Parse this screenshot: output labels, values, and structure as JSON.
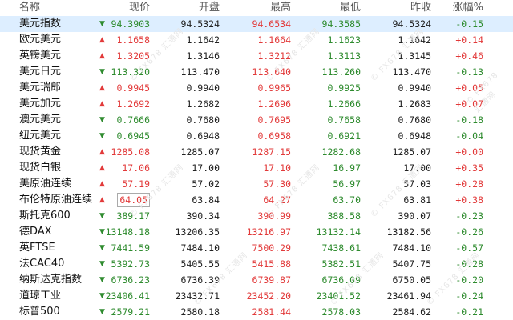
{
  "header": {
    "name": "名称",
    "current": "现价",
    "open": "开盘",
    "high": "最高",
    "low": "最低",
    "prev": "昨收",
    "change": "涨幅%"
  },
  "watermark": "© FX678 汇通网",
  "colors": {
    "up": "#e23a3a",
    "down": "#2e8b2e",
    "selected_row": "#ddeeff"
  },
  "rows": [
    {
      "name": "美元指数",
      "dir": "down",
      "current": "94.3903",
      "open": "94.5324",
      "high": "94.6534",
      "low": "94.3585",
      "prev": "94.5324",
      "change": "-0.15",
      "selected": true
    },
    {
      "name": "欧元美元",
      "dir": "up",
      "current": "1.1658",
      "open": "1.1642",
      "high": "1.1664",
      "low": "1.1623",
      "prev": "1.1642",
      "change": "+0.14"
    },
    {
      "name": "英镑美元",
      "dir": "up",
      "current": "1.3205",
      "open": "1.3146",
      "high": "1.3212",
      "low": "1.3113",
      "prev": "1.3145",
      "change": "+0.46"
    },
    {
      "name": "美元日元",
      "dir": "down",
      "current": "113.320",
      "open": "113.470",
      "high": "113.640",
      "low": "113.260",
      "prev": "113.470",
      "change": "-0.13"
    },
    {
      "name": "美元瑞郎",
      "dir": "up",
      "current": "0.9945",
      "open": "0.9940",
      "high": "0.9965",
      "low": "0.9925",
      "prev": "0.9940",
      "change": "+0.05"
    },
    {
      "name": "美元加元",
      "dir": "up",
      "current": "1.2692",
      "open": "1.2682",
      "high": "1.2696",
      "low": "1.2666",
      "prev": "1.2683",
      "change": "+0.07"
    },
    {
      "name": "澳元美元",
      "dir": "down",
      "current": "0.7666",
      "open": "0.7680",
      "high": "0.7695",
      "low": "0.7658",
      "prev": "0.7680",
      "change": "-0.18"
    },
    {
      "name": "纽元美元",
      "dir": "down",
      "current": "0.6945",
      "open": "0.6948",
      "high": "0.6958",
      "low": "0.6921",
      "prev": "0.6948",
      "change": "-0.04"
    },
    {
      "name": "现货黄金",
      "dir": "up",
      "current": "1285.08",
      "open": "1285.07",
      "high": "1287.15",
      "low": "1282.68",
      "prev": "1285.07",
      "change": "+0.00"
    },
    {
      "name": "现货白银",
      "dir": "up",
      "current": "17.06",
      "open": "17.00",
      "high": "17.10",
      "low": "16.97",
      "prev": "17.00",
      "change": "+0.35"
    },
    {
      "name": "美原油连续",
      "dir": "up",
      "current": "57.19",
      "open": "57.02",
      "high": "57.30",
      "low": "56.97",
      "prev": "57.03",
      "change": "+0.28"
    },
    {
      "name": "布伦特原油连续",
      "dir": "up",
      "current": "64.05",
      "open": "63.84",
      "high": "64.27",
      "low": "63.70",
      "prev": "63.81",
      "change": "+0.38",
      "boxed": true
    },
    {
      "name": "斯托克600",
      "dir": "down",
      "current": "389.17",
      "open": "390.34",
      "high": "390.99",
      "low": "388.58",
      "prev": "390.07",
      "change": "-0.23"
    },
    {
      "name": "德DAX",
      "dir": "down",
      "current": "13148.18",
      "open": "13206.35",
      "high": "13216.97",
      "low": "13132.14",
      "prev": "13182.56",
      "change": "-0.26"
    },
    {
      "name": "英FTSE",
      "dir": "down",
      "current": "7441.59",
      "open": "7484.10",
      "high": "7500.29",
      "low": "7438.61",
      "prev": "7484.10",
      "change": "-0.57"
    },
    {
      "name": "法CAC40",
      "dir": "down",
      "current": "5392.73",
      "open": "5405.55",
      "high": "5415.88",
      "low": "5382.51",
      "prev": "5407.75",
      "change": "-0.28"
    },
    {
      "name": "纳斯达克指数",
      "dir": "down",
      "current": "6736.23",
      "open": "6736.39",
      "high": "6739.87",
      "low": "6736.09",
      "prev": "6750.05",
      "change": "-0.20"
    },
    {
      "name": "道琼工业",
      "dir": "down",
      "current": "23406.41",
      "open": "23432.71",
      "high": "23452.20",
      "low": "23401.52",
      "prev": "23461.94",
      "change": "-0.24"
    },
    {
      "name": "标普500",
      "dir": "down",
      "current": "2579.21",
      "open": "2580.18",
      "high": "2581.44",
      "low": "2578.03",
      "prev": "2584.62",
      "change": "-0.21"
    }
  ]
}
